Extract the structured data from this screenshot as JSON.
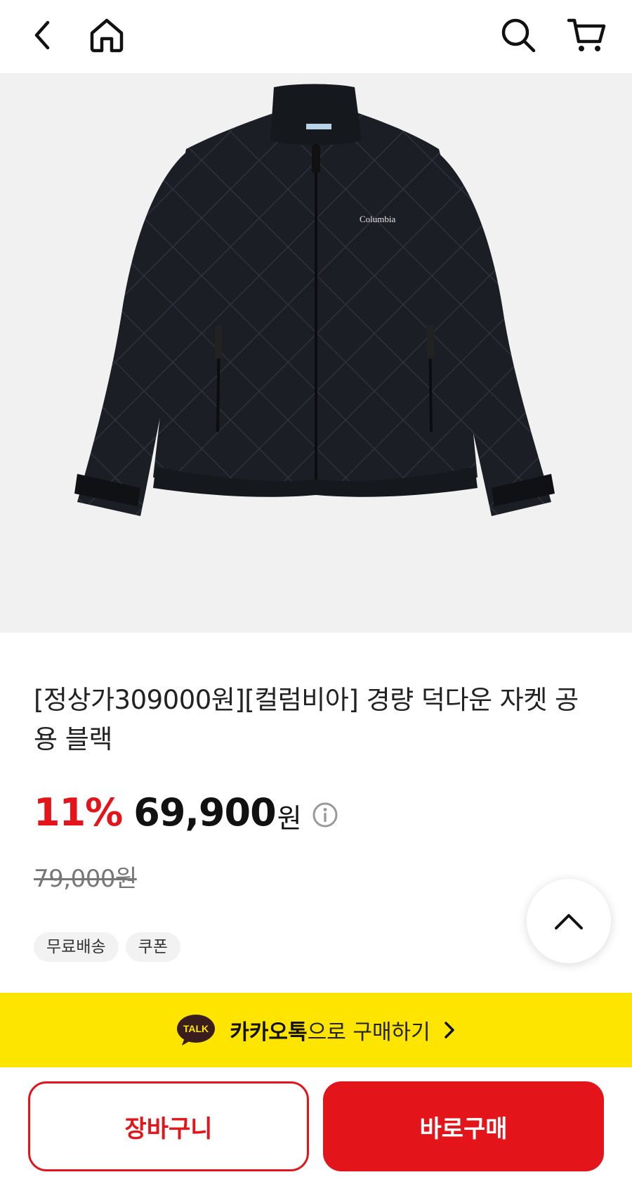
{
  "header": {
    "back_icon": "chevron-left-icon",
    "home_icon": "home-icon",
    "search_icon": "search-icon",
    "cart_icon": "cart-icon"
  },
  "product": {
    "image_alt": "black quilted down jacket",
    "brand_logo_text": "Columbia",
    "title": "[정상가309000원][컬럼비아] 경량 덕다운 자켓 공용 블랙",
    "discount": "11%",
    "price": "69,900",
    "currency": "원",
    "original_price": "79,000원",
    "tags": [
      "무료배송",
      "쿠폰"
    ]
  },
  "kakao": {
    "badge": "TALK",
    "strong": "카카오톡",
    "rest": "으로 구매하기"
  },
  "actions": {
    "cart_label": "장바구니",
    "buy_label": "바로구매"
  },
  "colors": {
    "accent": "#e4141b",
    "kakao_yellow": "#fee500",
    "image_bg": "#f1f1f1"
  }
}
